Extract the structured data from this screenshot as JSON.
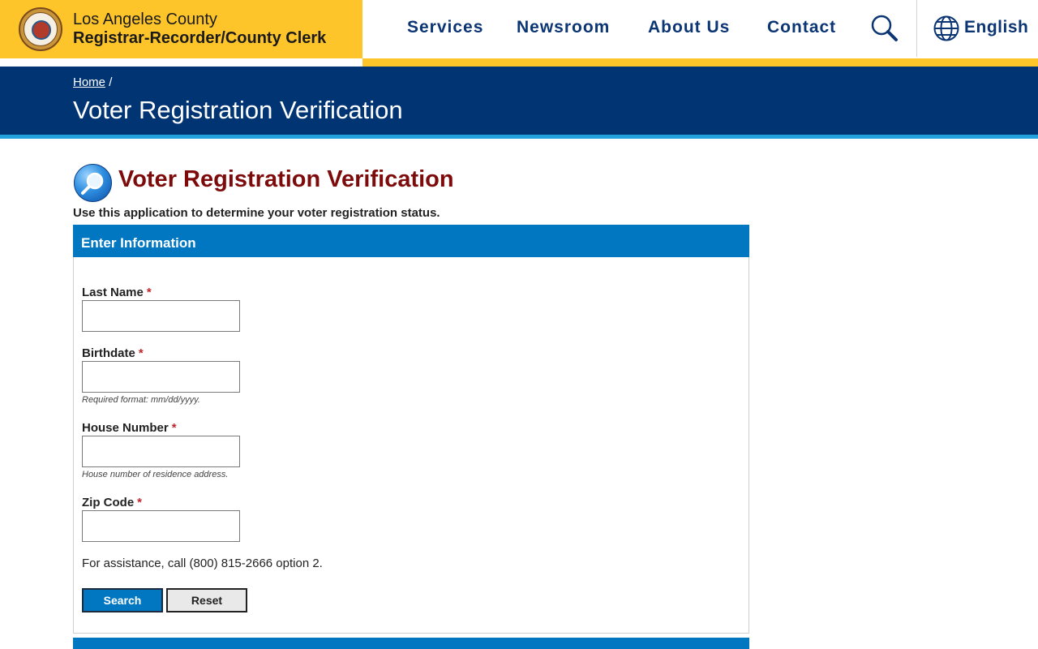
{
  "header": {
    "brand_line1": "Los Angeles County",
    "brand_line2": "Registrar-Recorder/County Clerk",
    "seal_icon": "county-seal-logo",
    "nav": [
      {
        "label": "Services"
      },
      {
        "label": "Newsroom"
      },
      {
        "label": "About Us"
      },
      {
        "label": "Contact"
      }
    ],
    "search_icon": "search-icon",
    "language": "English",
    "colors": {
      "brand_yellow": "#fec52b",
      "nav_text": "#0b3573"
    }
  },
  "banner": {
    "breadcrumb_home": "Home",
    "breadcrumb_sep": "/",
    "title": "Voter Registration Verification",
    "colors": {
      "background": "#003473",
      "stripe": "#22a1dc"
    }
  },
  "main": {
    "title": "Voter Registration Verification",
    "title_color": "#7e0b0b",
    "intro": "Use this application to determine your voter registration status.",
    "panel_title": "Enter Information",
    "required_marker": "*",
    "fields": [
      {
        "label": "Last Name",
        "value": "",
        "hint": ""
      },
      {
        "label": "Birthdate",
        "value": "",
        "hint": "Required format: mm/dd/yyyy."
      },
      {
        "label": "House Number",
        "value": "",
        "hint": "House number of residence address."
      },
      {
        "label": "Zip Code",
        "value": "",
        "hint": ""
      }
    ],
    "assistance": "For assistance, call (800) 815-2666 option 2.",
    "buttons": {
      "search": "Search",
      "reset": "Reset"
    },
    "accent_color": "#0077c0"
  }
}
